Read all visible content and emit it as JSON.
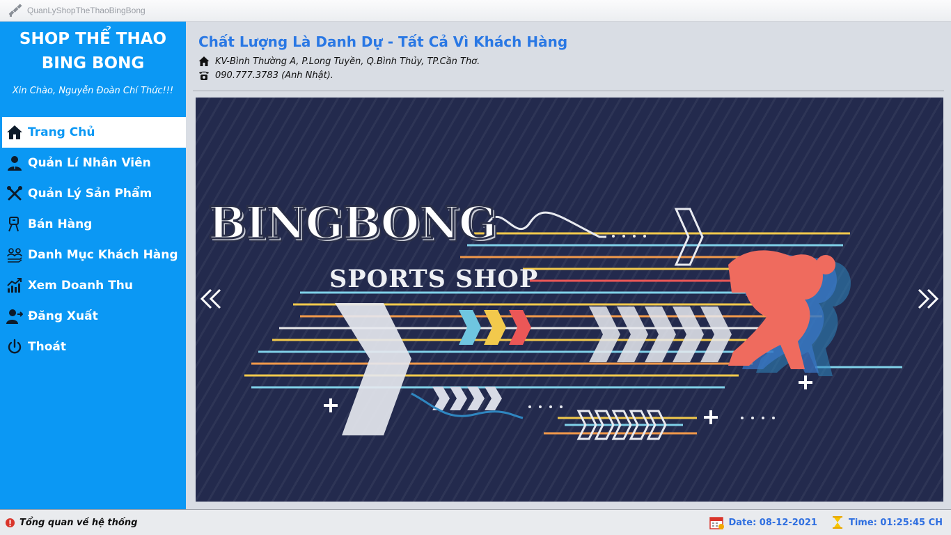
{
  "window": {
    "title": "QuanLyShopTheThaoBingBong"
  },
  "sidebar": {
    "brand_line1": "SHOP THỂ THAO",
    "brand_line2": "BING BONG",
    "greeting": "Xin Chào, Nguyễn Đoàn Chí Thức!!!",
    "items": [
      {
        "label": "Trang Chủ",
        "icon": "home-icon",
        "active": true
      },
      {
        "label": "Quản Lí Nhân Viên",
        "icon": "user-icon",
        "active": false
      },
      {
        "label": "Quản Lý Sản Phẩm",
        "icon": "tools-icon",
        "active": false
      },
      {
        "label": "Bán Hàng",
        "icon": "sell-icon",
        "active": false
      },
      {
        "label": "Danh Mục Khách Hàng",
        "icon": "customers-icon",
        "active": false
      },
      {
        "label": "Xem Doanh Thu",
        "icon": "chart-icon",
        "active": false
      },
      {
        "label": "Đăng Xuất",
        "icon": "logout-icon",
        "active": false
      },
      {
        "label": "Thoát",
        "icon": "power-icon",
        "active": false
      }
    ]
  },
  "header": {
    "slogan": "Chất Lượng Là Danh Dự - Tất Cả Vì Khách Hàng",
    "address": "KV-Bình Thường A, P.Long Tuyền, Q.Bình Thủy, TP.Cần Thơ.",
    "phone": "090.777.3783 (Anh Nhật)."
  },
  "banner": {
    "title": "BINGBONG",
    "subtitle": "SPORTS SHOP"
  },
  "status": {
    "overview": "Tổng quan về hệ thống",
    "date": "Date: 08-12-2021",
    "time": "Time: 01:25:45 CH"
  },
  "colors": {
    "sidebar": "#0b98f4",
    "accent": "#2a78e4",
    "banner_bg": "#232a4d",
    "runner": "#ef5b5b"
  }
}
